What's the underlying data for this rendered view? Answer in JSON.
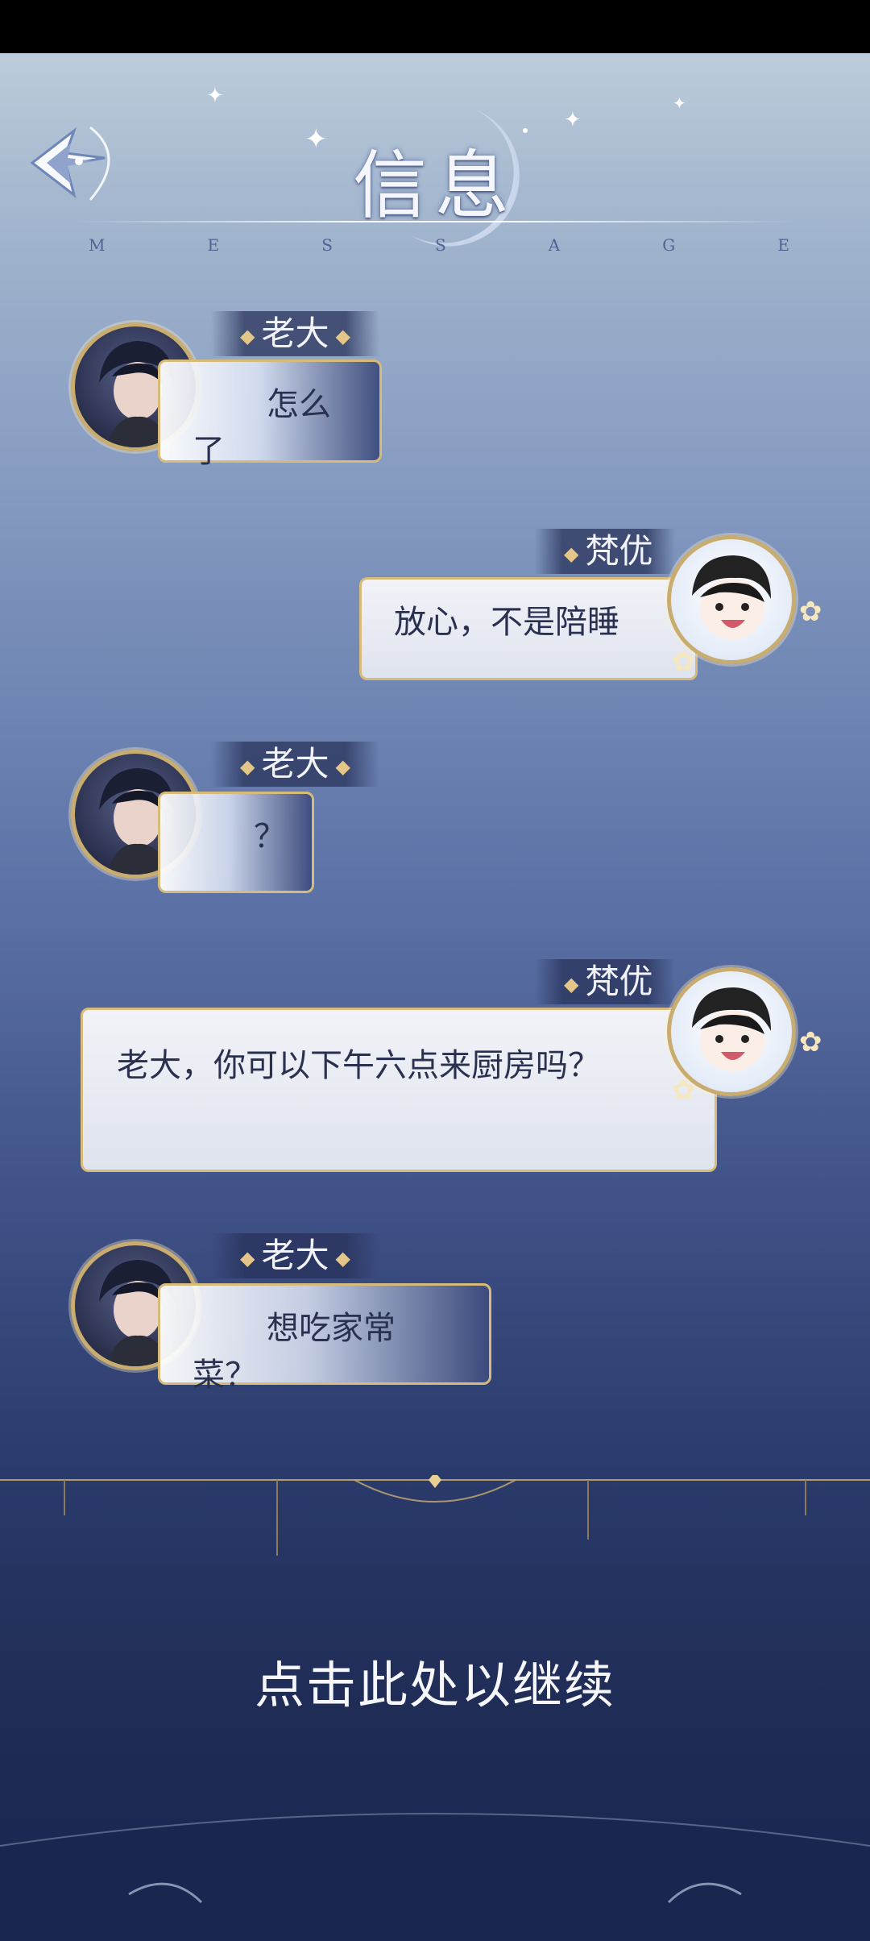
{
  "header": {
    "title": "信息",
    "subtitle_letters": [
      "M",
      "E",
      "S",
      "S",
      "A",
      "G",
      "E"
    ]
  },
  "messages": [
    {
      "side": "left",
      "speaker": "老大",
      "text": "怎么了",
      "avatar_icon": "boss-portrait"
    },
    {
      "side": "right",
      "speaker": "梵优",
      "text": "放心，不是陪睡",
      "avatar_icon": "chibi-portrait"
    },
    {
      "side": "left",
      "speaker": "老大",
      "text": "？",
      "avatar_icon": "boss-portrait"
    },
    {
      "side": "right",
      "speaker": "梵优",
      "text": "老大，你可以下午六点来厨房吗？",
      "avatar_icon": "chibi-portrait"
    },
    {
      "side": "left",
      "speaker": "老大",
      "text": "想吃家常菜？",
      "avatar_icon": "boss-portrait"
    }
  ],
  "footer": {
    "continue_label": "点击此处以继续"
  },
  "colors": {
    "accent_gold": "#d6bb7a",
    "bg_top": "#c6d4e0",
    "bg_bottom": "#1a2550"
  }
}
